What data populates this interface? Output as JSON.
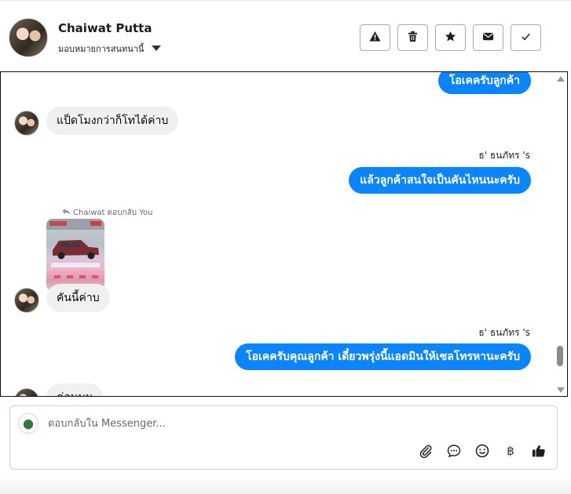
{
  "header": {
    "contact_name": "Chaiwat Putta",
    "assign_label": "มอบหมายการสนทนานี้",
    "actions": [
      "report-icon",
      "delete-icon",
      "star-icon",
      "envelope-icon",
      "check-icon"
    ]
  },
  "messages": {
    "m1": "โอเคครับลูกค้า",
    "m2": "แป็ดโมงกว่าก็โทได้ค่าบ",
    "m3_sender": "ธ' ธนภัทร 's",
    "m3": "แล้วลูกค้าสนใจเป็นคันไหนนะครับ",
    "reply_note": "Chaiwat ตอบกลับ You",
    "m4": "คันนี้ค่าบ",
    "m5_sender": "ธ' ธนภัทร 's",
    "m5": "โอเคครับคุณลูกค้า เดี๋ยวพรุ่งนี้แอดมินให้เซลโทรหานะครับ",
    "m6": "ค่อนนน"
  },
  "composer": {
    "placeholder": "ตอบกลับใน Messenger...",
    "icons": [
      "attachment-icon",
      "saved-reply-icon",
      "emoji-icon",
      "baht-icon",
      "like-icon"
    ],
    "baht_glyph": "฿"
  },
  "colors": {
    "outgoing": "#0b84ff",
    "incoming": "#f0f0f0"
  }
}
